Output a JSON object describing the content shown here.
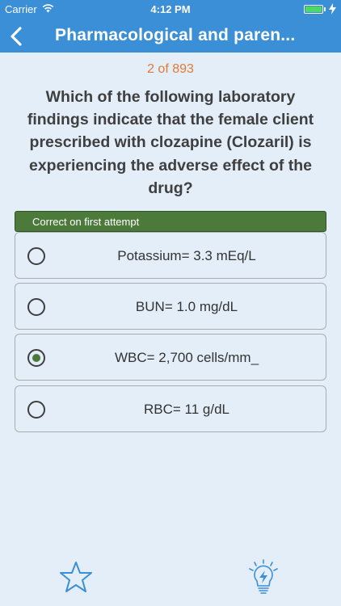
{
  "status_bar": {
    "carrier": "Carrier",
    "time": "4:12 PM",
    "battery_color": "#4cd964"
  },
  "header": {
    "title": "Pharmacological and paren...",
    "back_icon": "chevron-left-icon",
    "color": "#3a8fd6"
  },
  "progress": {
    "text": "2 of 893"
  },
  "question": {
    "text": "Which of the following laboratory findings indicate that the female client prescribed with clozapine (Clozaril) is experiencing the adverse effect of the drug?"
  },
  "feedback": {
    "text": "Correct on first attempt",
    "color": "#4c7a3a"
  },
  "options": [
    {
      "label": "Potassium= 3.3  mEq/L",
      "selected": false
    },
    {
      "label": "BUN= 1.0 mg/dL",
      "selected": false
    },
    {
      "label": "WBC= 2,700 cells/mm_",
      "selected": true
    },
    {
      "label": "RBC= 11 g/dL",
      "selected": false
    }
  ],
  "toolbar": {
    "favorite_icon": "star-icon",
    "hint_icon": "lightbulb-icon",
    "icon_color": "#3a8fd6"
  }
}
